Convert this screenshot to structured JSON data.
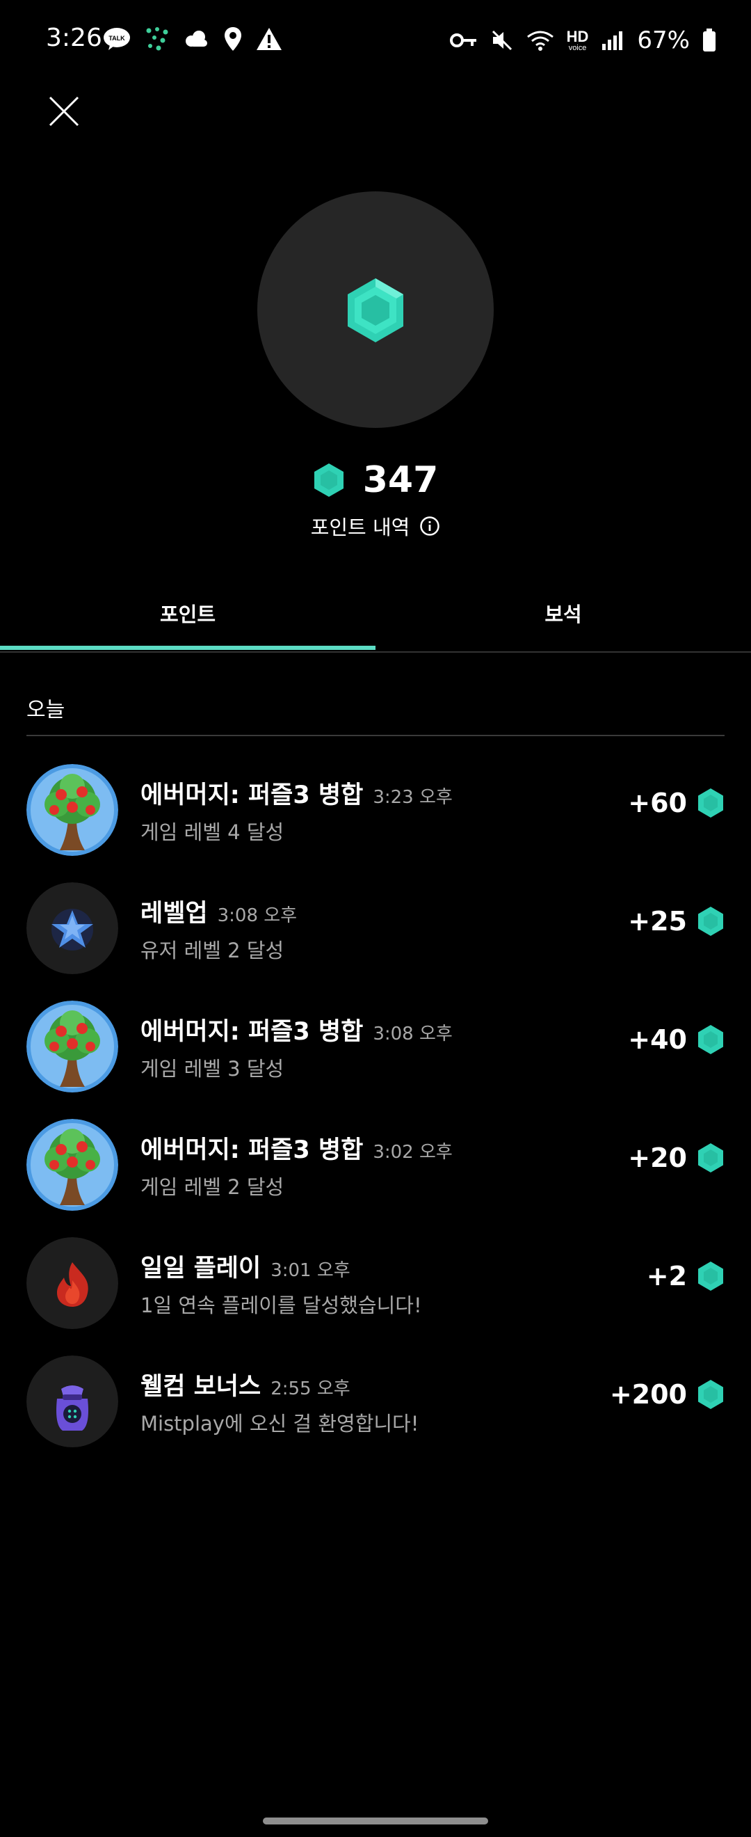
{
  "status_bar": {
    "time": "3:26",
    "battery": "67%",
    "left_icons": [
      "talk-icon",
      "dots-app-icon",
      "cloud-icon",
      "location-icon",
      "warning-icon"
    ],
    "right_icons": [
      "key-icon",
      "mute-icon",
      "wifi-icon",
      "hd-voice-icon",
      "signal-icon",
      "battery-icon"
    ],
    "hd_label": "HD",
    "voice_label": "voice"
  },
  "header": {
    "close_icon": "close-icon",
    "total_points": "347",
    "history_label": "포인트 내역",
    "info_icon": "info-icon"
  },
  "tabs": [
    {
      "label": "포인트",
      "active": true
    },
    {
      "label": "보석",
      "active": false
    }
  ],
  "section": {
    "title": "오늘"
  },
  "items": [
    {
      "title": "에버머지: 퍼즐3 병합",
      "time": "3:23 오후",
      "subtitle": "게임 레벨 4 달성",
      "reward": "+60",
      "icon": "apple-tree-icon"
    },
    {
      "title": "레벨업",
      "time": "3:08 오후",
      "subtitle": "유저 레벨 2 달성",
      "reward": "+25",
      "icon": "star-icon"
    },
    {
      "title": "에버머지: 퍼즐3 병합",
      "time": "3:08 오후",
      "subtitle": "게임 레벨 3 달성",
      "reward": "+40",
      "icon": "apple-tree-icon"
    },
    {
      "title": "에버머지: 퍼즐3 병합",
      "time": "3:02 오후",
      "subtitle": "게임 레벨 2 달성",
      "reward": "+20",
      "icon": "apple-tree-icon"
    },
    {
      "title": "일일 플레이",
      "time": "3:01 오후",
      "subtitle": "1일 연속 플레이를 달성했습니다!",
      "reward": "+2",
      "icon": "flame-icon"
    },
    {
      "title": "웰컴 보너스",
      "time": "2:55 오후",
      "subtitle": "Mistplay에 오신 걸 환영합니다!",
      "reward": "+200",
      "icon": "gift-bag-icon"
    }
  ],
  "colors": {
    "accent": "#5cdcc4",
    "gem": "#2fd1b4",
    "background": "#000000",
    "secondary_text": "#a8a8a8"
  }
}
